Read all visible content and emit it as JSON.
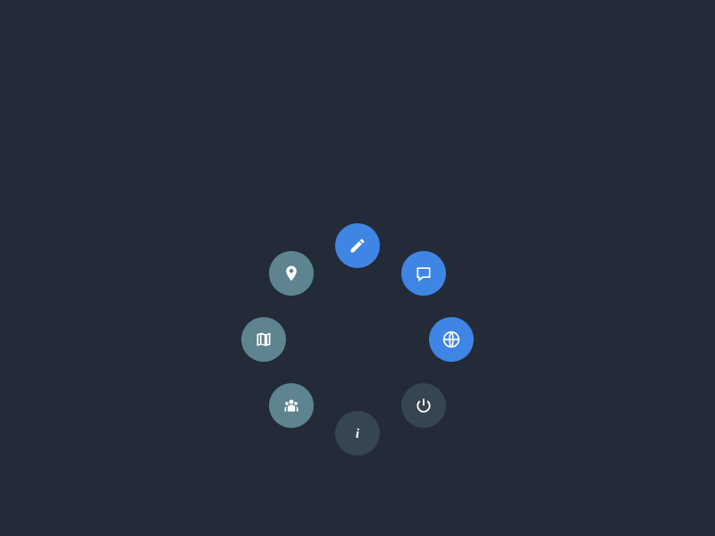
{
  "radial": {
    "radius": 105,
    "items": [
      {
        "id": "edit",
        "icon": "pencil-icon",
        "color": "clr-blue",
        "angle": -90
      },
      {
        "id": "note",
        "icon": "note-icon",
        "color": "clr-blue",
        "angle": -45
      },
      {
        "id": "globe",
        "icon": "globe-icon",
        "color": "clr-blue",
        "angle": 0
      },
      {
        "id": "power",
        "icon": "power-icon",
        "color": "clr-dark",
        "angle": 45
      },
      {
        "id": "info",
        "icon": "info-icon",
        "color": "clr-dark",
        "angle": 90
      },
      {
        "id": "group",
        "icon": "group-icon",
        "color": "clr-teal",
        "angle": 135
      },
      {
        "id": "map",
        "icon": "map-icon",
        "color": "clr-teal",
        "angle": 180
      },
      {
        "id": "marker",
        "icon": "marker-icon",
        "color": "clr-teal",
        "angle": 225
      }
    ]
  },
  "colors": {
    "background": "#222b37",
    "blue": "#3f86e4",
    "teal": "#5d848f",
    "dark": "#354552",
    "icon": "#ffffff"
  }
}
